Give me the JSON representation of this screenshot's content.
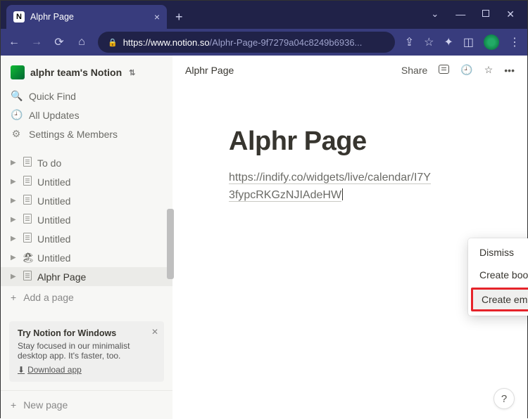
{
  "browser": {
    "tab_title": "Alphr Page",
    "url_domain": "https://www.notion.so",
    "url_path": "/Alphr-Page-9f7279a04c8249b6936..."
  },
  "workspace": {
    "name": "alphr team's Notion"
  },
  "sidebar_nav": {
    "quick_find": "Quick Find",
    "all_updates": "All Updates",
    "settings": "Settings & Members"
  },
  "pages": [
    {
      "label": "To do",
      "icon": "doc"
    },
    {
      "label": "Untitled",
      "icon": "doc"
    },
    {
      "label": "Untitled",
      "icon": "doc"
    },
    {
      "label": "Untitled",
      "icon": "doc"
    },
    {
      "label": "Untitled",
      "icon": "doc"
    },
    {
      "label": "Untitled",
      "icon": "beach"
    },
    {
      "label": "Alphr Page",
      "icon": "doc",
      "active": true
    }
  ],
  "add_page": "Add a page",
  "promo": {
    "title": "Try Notion for Windows",
    "body": "Stay focused in our minimalist desktop app. It's faster, too.",
    "cta": "Download app"
  },
  "new_page": "New page",
  "topbar": {
    "breadcrumb": "Alphr Page",
    "share": "Share"
  },
  "page": {
    "title": "Alphr Page",
    "link_line1": "https://indify.co/widgets/live/calendar/I7Y",
    "link_line2": "3fypcRKGzNJIAdeHW"
  },
  "menu": {
    "dismiss": "Dismiss",
    "bookmark": "Create bookmark",
    "embed": "Create embed"
  },
  "help": "?"
}
